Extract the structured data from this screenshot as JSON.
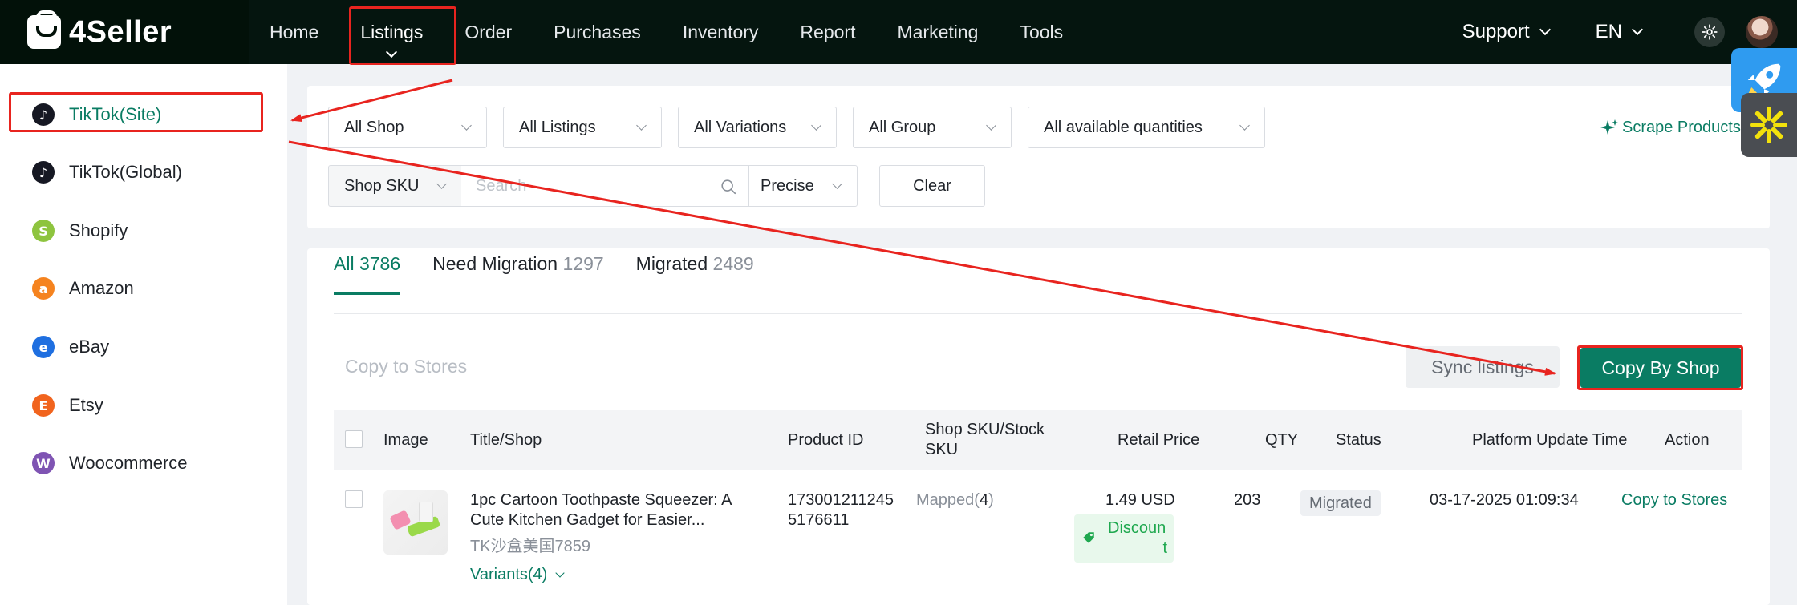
{
  "brand": {
    "name": "4Seller"
  },
  "nav": {
    "items": [
      {
        "label": "Home"
      },
      {
        "label": "Listings"
      },
      {
        "label": "Order"
      },
      {
        "label": "Purchases"
      },
      {
        "label": "Inventory"
      },
      {
        "label": "Report"
      },
      {
        "label": "Marketing"
      },
      {
        "label": "Tools"
      }
    ],
    "active": "Listings",
    "support_label": "Support",
    "language_label": "EN"
  },
  "sidebar": {
    "items": [
      {
        "label": "TikTok(Site)",
        "icon": "tiktok-icon",
        "color": "#161823"
      },
      {
        "label": "TikTok(Global)",
        "icon": "tiktok-icon",
        "color": "#161823"
      },
      {
        "label": "Shopify",
        "icon": "shopify-icon",
        "color": "#8ec43f"
      },
      {
        "label": "Amazon",
        "icon": "amazon-icon",
        "color": "#f5831f"
      },
      {
        "label": "eBay",
        "icon": "ebay-icon",
        "color": "#1f6fe0"
      },
      {
        "label": "Etsy",
        "icon": "etsy-icon",
        "color": "#f1641e"
      },
      {
        "label": "Woocommerce",
        "icon": "woocommerce-icon",
        "color": "#7f54b3"
      }
    ],
    "active": "TikTok(Site)"
  },
  "filters": {
    "shop": "All Shop",
    "listings": "All Listings",
    "variations": "All Variations",
    "group": "All Group",
    "quantities": "All available quantities",
    "sku_field": "Shop SKU",
    "search_placeholder": "Search",
    "match_mode": "Precise",
    "clear_label": "Clear",
    "scrape_label": "Scrape Products"
  },
  "tabs": [
    {
      "label": "All",
      "count": "3786"
    },
    {
      "label": "Need Migration",
      "count": "1297"
    },
    {
      "label": "Migrated",
      "count": "2489"
    }
  ],
  "toolbar": {
    "copy_to_stores": "Copy to Stores",
    "sync_listings": "Sync listings",
    "copy_by_shop": "Copy By Shop"
  },
  "table": {
    "headers": {
      "image": "Image",
      "title": "Title/Shop",
      "product_id": "Product ID",
      "sku_line1": "Shop SKU/Stock",
      "sku_line2": "SKU",
      "price": "Retail Price",
      "qty": "QTY",
      "status": "Status",
      "update_time": "Platform Update Time",
      "action": "Action"
    },
    "rows": [
      {
        "title_line1": "1pc Cartoon Toothpaste Squeezer: A",
        "title_line2": "Cute Kitchen Gadget for Easier...",
        "shop": "TK沙盒美国7859",
        "variants": "Variants(4)",
        "product_id_line1": "173001211245",
        "product_id_line2": "5176611",
        "mapped_label": "Mapped(",
        "mapped_count": "4",
        "mapped_close": ")",
        "price": "1.49 USD",
        "discount_line1": "Discoun",
        "discount_line2": "t",
        "qty": "203",
        "status": "Migrated",
        "update_time": "03-17-2025 01:09:34",
        "action": "Copy to Stores"
      }
    ]
  },
  "colors": {
    "accent": "#0a7c63",
    "nav_bg": "#05150f",
    "annotation": "#e8241f"
  }
}
